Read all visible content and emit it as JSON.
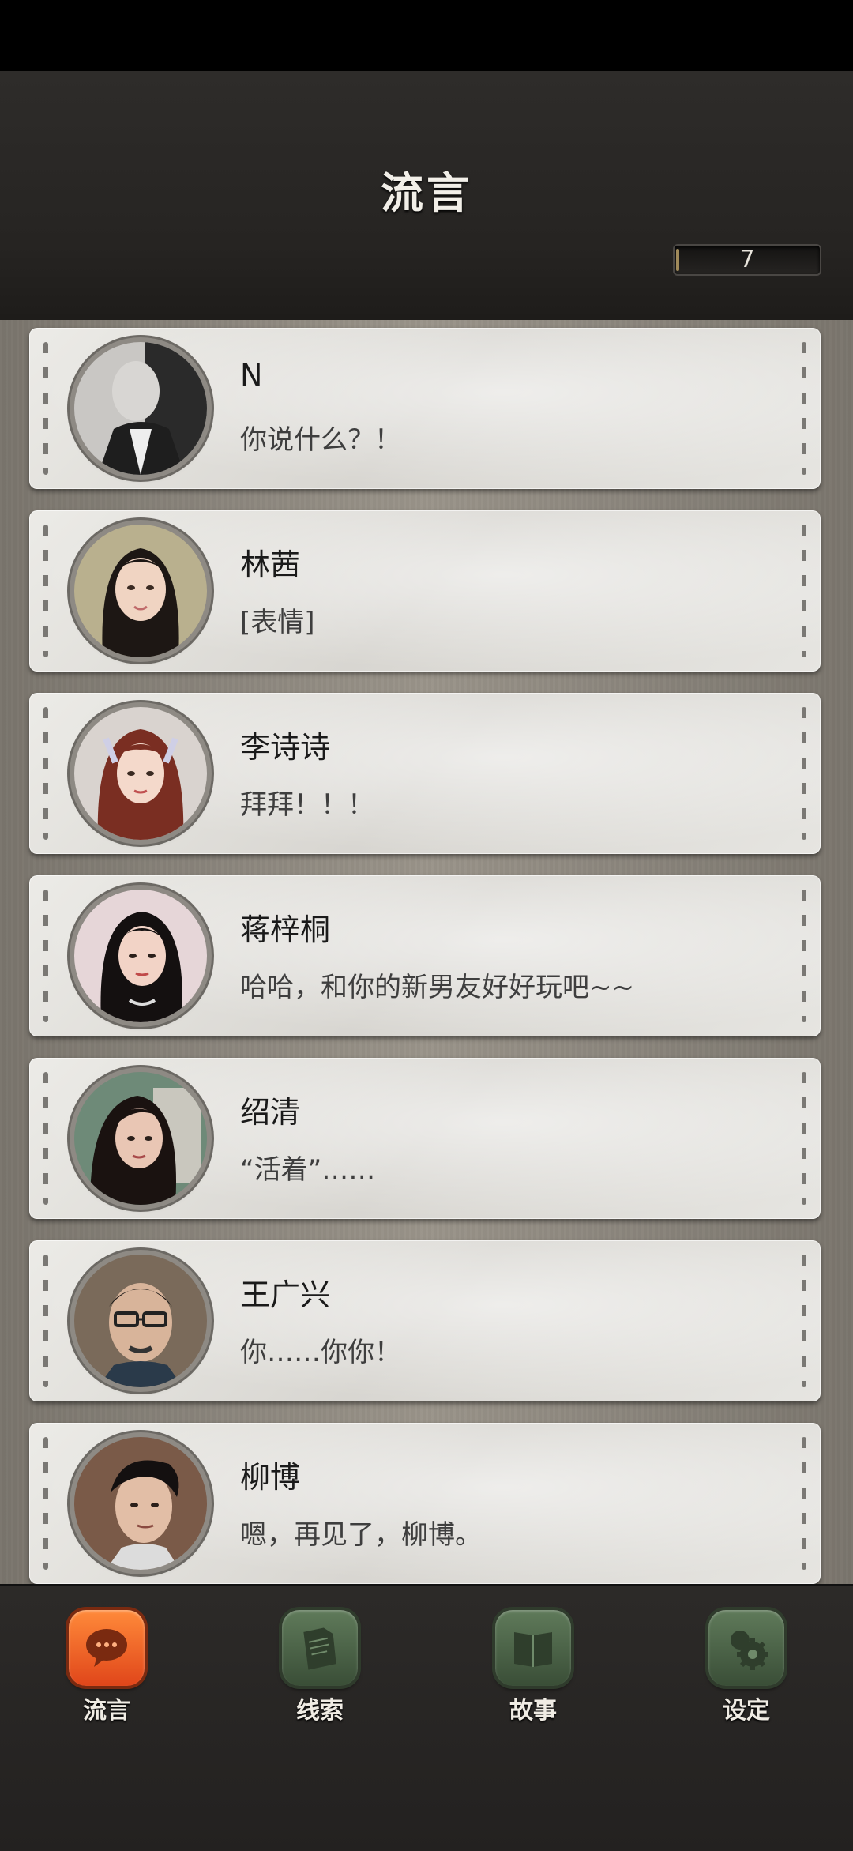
{
  "header": {
    "title": "流言",
    "counter_value": "7"
  },
  "messages": [
    {
      "name": "N",
      "message": "你说什么？！",
      "avatar_icon": "avatar-man-hidden-face-icon"
    },
    {
      "name": "林茜",
      "message": "[表情]",
      "avatar_icon": "avatar-woman-icon"
    },
    {
      "name": "李诗诗",
      "message": "拜拜！！！",
      "avatar_icon": "avatar-woman-icon"
    },
    {
      "name": "蒋梓桐",
      "message": "哈哈，和你的新男友好好玩吧~~",
      "avatar_icon": "avatar-woman-icon"
    },
    {
      "name": "绍清",
      "message": "“活着”……",
      "avatar_icon": "avatar-woman-icon"
    },
    {
      "name": "王广兴",
      "message": "你……你你！",
      "avatar_icon": "avatar-man-glasses-icon"
    },
    {
      "name": "柳博",
      "message": "嗯，再见了，柳博。",
      "avatar_icon": "avatar-man-icon"
    }
  ],
  "nav": {
    "items": [
      {
        "label": "流言",
        "icon": "chat-bubble-icon",
        "active": true
      },
      {
        "label": "线索",
        "icon": "document-icon",
        "active": false
      },
      {
        "label": "故事",
        "icon": "book-icon",
        "active": false
      },
      {
        "label": "设定",
        "icon": "gear-icon",
        "active": false
      }
    ]
  },
  "colors": {
    "active_tab": "#e0461a",
    "inactive_tab": "#4a6246",
    "card_bg": "#e2e1dd",
    "header_bg": "#2a2826"
  }
}
